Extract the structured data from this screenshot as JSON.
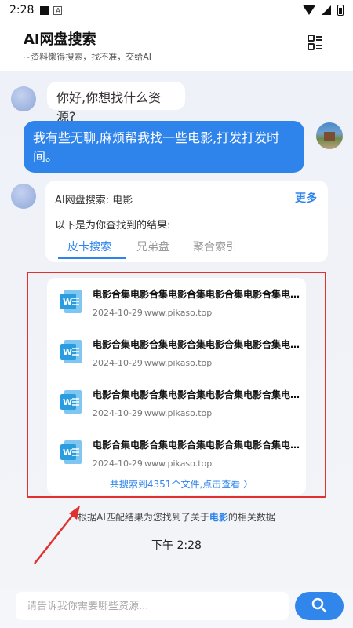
{
  "status_bar": {
    "time": "2:28",
    "badge_letter": "A"
  },
  "header": {
    "title": "AI网盘搜索",
    "subtitle": "~资料懒得搜索，找不准，交给AI"
  },
  "chat": {
    "greeting": "你好,你想找什么资源?",
    "user_message": "我有些无聊,麻烦帮我找一些电影,打发打发时间。",
    "result_card": {
      "title": "AI网盘搜索: 电影",
      "more_label": "更多",
      "subtitle": "以下是为你查找到的结果:",
      "tabs": [
        "皮卡搜索",
        "兄弟盘",
        "聚合索引"
      ],
      "active_tab": "皮卡搜索"
    },
    "files": [
      {
        "title": "电影合集电影合集电影合集电影合集电影合集电影...",
        "date": "2024-10-29",
        "site": "www.pikaso.top"
      },
      {
        "title": "电影合集电影合集电影合集电影合集电影合集电影...",
        "date": "2024-10-29",
        "site": "www.pikaso.top"
      },
      {
        "title": "电影合集电影合集电影合集电影合集电影合集电影...",
        "date": "2024-10-29",
        "site": "www.pikaso.top"
      },
      {
        "title": "电影合集电影合集电影合集电影合集电影合集电影...",
        "date": "2024-10-29",
        "site": "www.pikaso.top"
      }
    ],
    "total_link": "一共搜索到4351个文件,点击查看 〉",
    "summary": {
      "prefix": "根据AI匹配结果为您找到了关于",
      "keyword": "电影",
      "suffix": "的相关数据"
    },
    "timestamp": "下午 2:28"
  },
  "input": {
    "placeholder": "请告诉我你需要哪些资源..."
  },
  "colors": {
    "accent": "#2f84ec",
    "highlight_border": "#e03030",
    "user_bubble": "#2f84ec"
  }
}
